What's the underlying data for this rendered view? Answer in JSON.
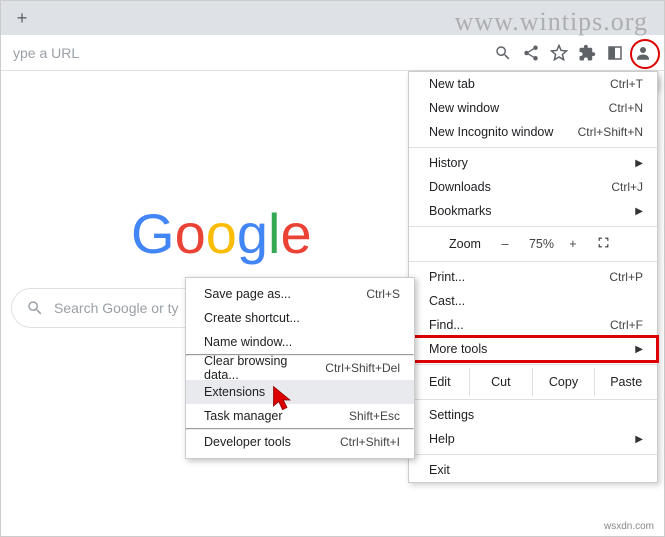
{
  "watermark": "www.wintips.org",
  "omnibox_placeholder": "ype a URL",
  "search_placeholder": "Search Google or ty",
  "logo_letters": [
    "G",
    "o",
    "o",
    "g",
    "l",
    "e"
  ],
  "main_menu": {
    "new_tab": {
      "label": "New tab",
      "shortcut": "Ctrl+T"
    },
    "new_window": {
      "label": "New window",
      "shortcut": "Ctrl+N"
    },
    "incognito": {
      "label": "New Incognito window",
      "shortcut": "Ctrl+Shift+N"
    },
    "history": {
      "label": "History"
    },
    "downloads": {
      "label": "Downloads",
      "shortcut": "Ctrl+J"
    },
    "bookmarks": {
      "label": "Bookmarks"
    },
    "zoom": {
      "label": "Zoom",
      "minus": "–",
      "value": "75%",
      "plus": "+"
    },
    "print": {
      "label": "Print...",
      "shortcut": "Ctrl+P"
    },
    "cast": {
      "label": "Cast..."
    },
    "find": {
      "label": "Find...",
      "shortcut": "Ctrl+F"
    },
    "more_tools": {
      "label": "More tools"
    },
    "edit": {
      "label": "Edit",
      "cut": "Cut",
      "copy": "Copy",
      "paste": "Paste"
    },
    "settings": {
      "label": "Settings"
    },
    "help": {
      "label": "Help"
    },
    "exit": {
      "label": "Exit"
    }
  },
  "submenu": {
    "save_page": {
      "label": "Save page as...",
      "shortcut": "Ctrl+S"
    },
    "create_shortcut": {
      "label": "Create shortcut..."
    },
    "name_window": {
      "label": "Name window..."
    },
    "clear_data": {
      "label": "Clear browsing data...",
      "shortcut": "Ctrl+Shift+Del"
    },
    "extensions": {
      "label": "Extensions"
    },
    "task_manager": {
      "label": "Task manager",
      "shortcut": "Shift+Esc"
    },
    "dev_tools": {
      "label": "Developer tools",
      "shortcut": "Ctrl+Shift+I"
    }
  },
  "footer": "wsxdn.com"
}
